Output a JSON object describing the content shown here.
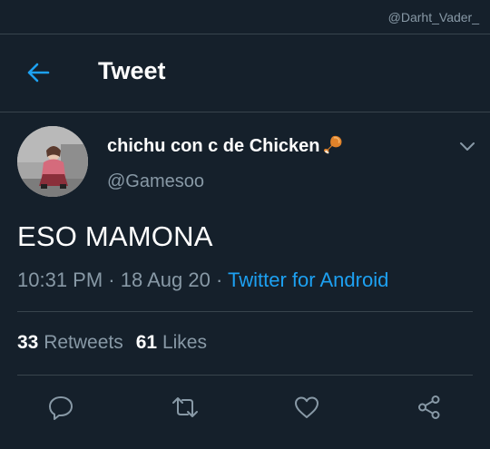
{
  "watermark": "@Darht_Vader_",
  "header": {
    "title": "Tweet",
    "back_icon": "arrow-left-icon",
    "accent_color": "#1da1f2"
  },
  "tweet": {
    "display_name": "chichu con c de Chicken",
    "name_emoji": "poultry-leg-icon",
    "handle": "@Gamesoo",
    "text": "ESO MAMONA",
    "time": "10:31 PM",
    "date": "18 Aug 20",
    "separator": "·",
    "source": "Twitter for Android"
  },
  "stats": {
    "retweets_count": "33",
    "retweets_label": "Retweets",
    "likes_count": "61",
    "likes_label": "Likes"
  },
  "actions": [
    "reply-icon",
    "retweet-icon",
    "like-icon",
    "share-icon"
  ],
  "colors": {
    "background": "#15202b",
    "muted_text": "#8899a6",
    "divider": "#38444d",
    "link": "#1da1f2"
  }
}
